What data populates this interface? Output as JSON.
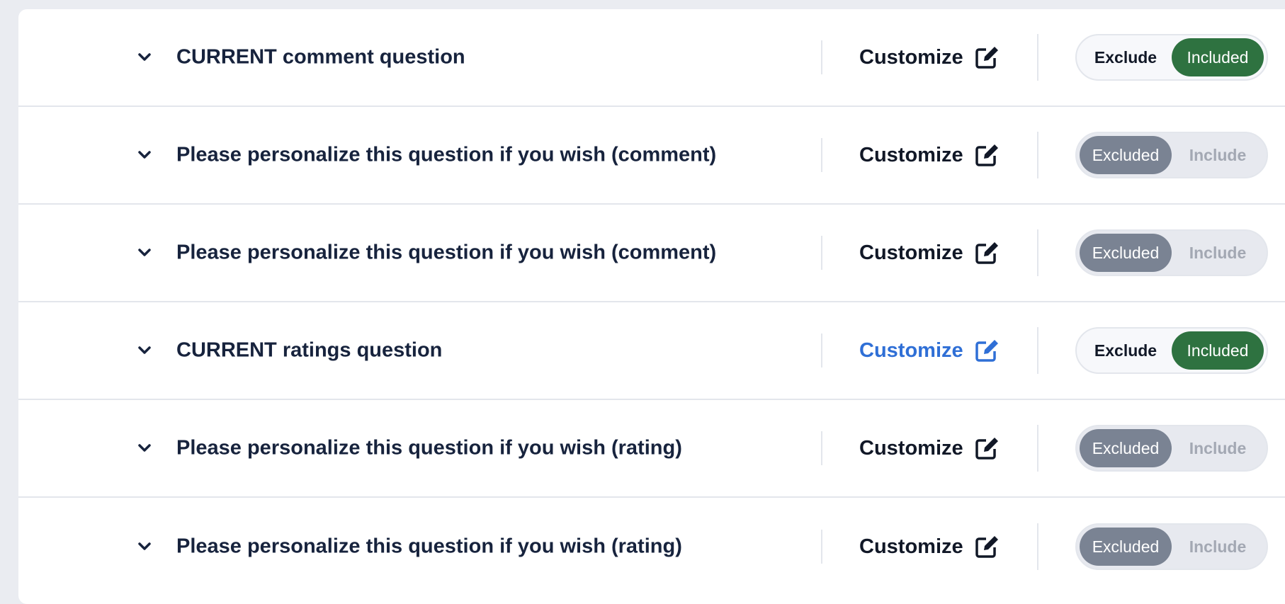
{
  "colors": {
    "included_bg": "#2e7240",
    "excluded_bg": "#7a8393",
    "active_link": "#2f6fd6",
    "title_text": "#17233d"
  },
  "icons": {
    "expand": "chevron-down-icon",
    "customize": "edit-square-icon"
  },
  "questions": [
    {
      "title": "CURRENT comment question",
      "customize_label": "Customize",
      "customize_active": false,
      "included": true,
      "left_label": "Exclude",
      "right_label": "Included"
    },
    {
      "title": "Please personalize this question if you wish (comment)",
      "customize_label": "Customize",
      "customize_active": false,
      "included": false,
      "left_label": "Excluded",
      "right_label": "Include"
    },
    {
      "title": "Please personalize this question if you wish (comment)",
      "customize_label": "Customize",
      "customize_active": false,
      "included": false,
      "left_label": "Excluded",
      "right_label": "Include"
    },
    {
      "title": "CURRENT ratings question",
      "customize_label": "Customize",
      "customize_active": true,
      "included": true,
      "left_label": "Exclude",
      "right_label": "Included"
    },
    {
      "title": "Please personalize this question if you wish (rating)",
      "customize_label": "Customize",
      "customize_active": false,
      "included": false,
      "left_label": "Excluded",
      "right_label": "Include"
    },
    {
      "title": "Please personalize this question if you wish (rating)",
      "customize_label": "Customize",
      "customize_active": false,
      "included": false,
      "left_label": "Excluded",
      "right_label": "Include"
    }
  ]
}
